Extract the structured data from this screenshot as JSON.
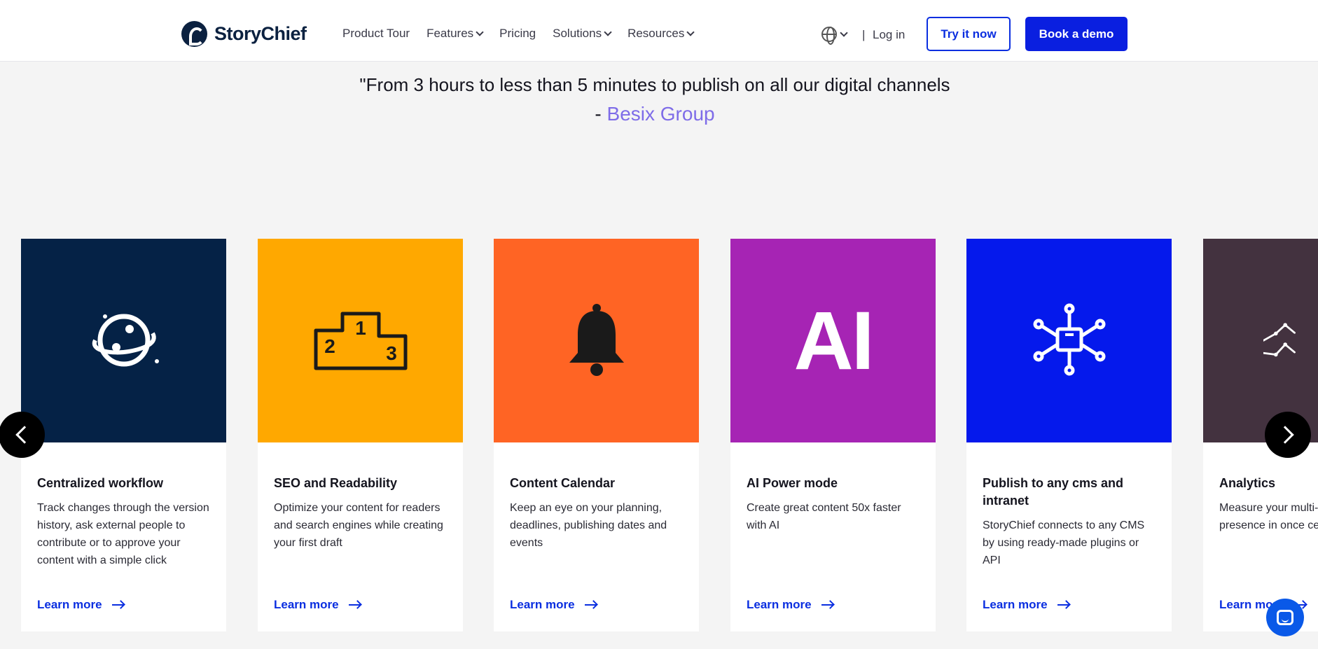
{
  "header": {
    "brand": "StoryChief",
    "nav": [
      {
        "label": "Product Tour",
        "has_dropdown": false
      },
      {
        "label": "Features",
        "has_dropdown": true
      },
      {
        "label": "Pricing",
        "has_dropdown": false
      },
      {
        "label": "Solutions",
        "has_dropdown": true
      },
      {
        "label": "Resources",
        "has_dropdown": true
      }
    ],
    "separator": "|",
    "login": "Log in",
    "try_label": "Try it now",
    "demo_label": "Book a demo"
  },
  "testimonial": {
    "quote": "\"From 3 hours to less than 5 minutes to publish on all our digital channels",
    "dash": "- ",
    "company": "Besix Group"
  },
  "cards": [
    {
      "title": "Centralized workflow",
      "desc": "Track changes through the version history, ask external people to contribute or to approve your content with a simple click",
      "learn": "Learn more",
      "color": "#052246",
      "icon": "planet-icon"
    },
    {
      "title": "SEO and Readability",
      "desc": "Optimize your content for readers and search engines while creating your first draft",
      "learn": "Learn more",
      "color": "#ffa800",
      "icon": "podium-icon",
      "podium": [
        "1",
        "2",
        "3"
      ]
    },
    {
      "title": "Content Calendar",
      "desc": "Keep an eye on your planning, deadlines, publishing dates and events",
      "learn": "Learn more",
      "color": "#ff6424",
      "icon": "bell-icon"
    },
    {
      "title": "AI Power mode",
      "desc": "Create great content 50x faster with AI",
      "learn": "Learn more",
      "color": "#a624b4",
      "icon": "ai-icon",
      "icon_text": "AI"
    },
    {
      "title": "Publish to any cms and intranet",
      "desc": "StoryChief connects to any CMS by using ready-made plugins or API",
      "learn": "Learn more",
      "color": "#0519ec",
      "icon": "network-hub-icon"
    },
    {
      "title": "Analytics",
      "desc": "Measure your multi-channel presence in once central dashboard",
      "learn": "Learn more",
      "color": "#43323f",
      "icon": "line-chart-icon"
    }
  ],
  "carousel": {
    "prev_icon": "chevron-left-icon",
    "next_icon": "chevron-right-icon"
  },
  "chat": {
    "icon": "chat-icon",
    "color": "#0a59e8"
  }
}
